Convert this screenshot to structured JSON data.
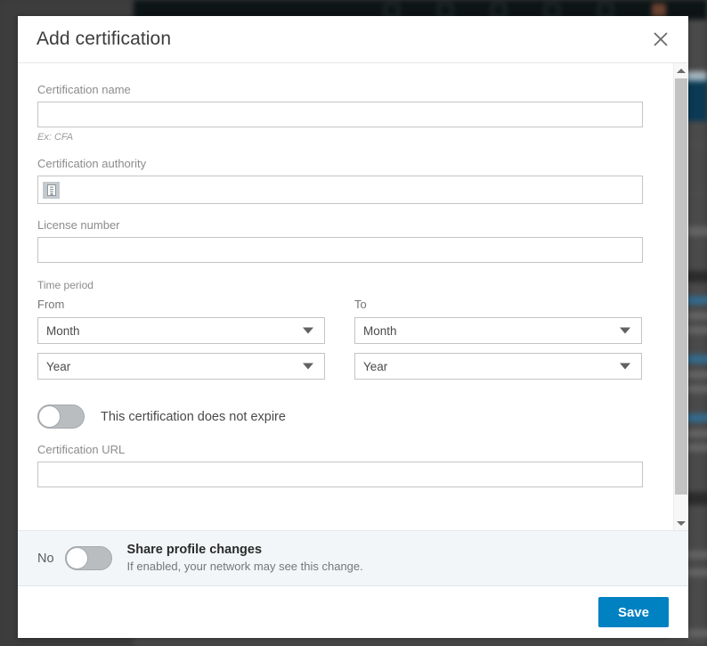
{
  "dialog": {
    "title": "Add certification",
    "close_icon": "close-icon"
  },
  "form": {
    "certification_name": {
      "label": "Certification name",
      "value": "",
      "placeholder": "",
      "hint": "Ex: CFA"
    },
    "certification_authority": {
      "label": "Certification authority",
      "value": "",
      "placeholder": "",
      "icon": "company-building-icon"
    },
    "license_number": {
      "label": "License number",
      "value": "",
      "placeholder": ""
    },
    "time_period": {
      "section_label": "Time period",
      "from": {
        "label": "From",
        "month": "Month",
        "year": "Year"
      },
      "to": {
        "label": "To",
        "month": "Month",
        "year": "Year"
      }
    },
    "no_expire_toggle": {
      "label": "This certification does not expire",
      "state": "off"
    },
    "certification_url": {
      "label": "Certification URL",
      "value": "",
      "placeholder": ""
    }
  },
  "share_bar": {
    "state_label": "No",
    "title": "Share profile changes",
    "subtitle": "If enabled, your network may see this change.",
    "toggle_state": "off"
  },
  "actions": {
    "save_label": "Save"
  },
  "colors": {
    "accent": "#0081c2",
    "share_bar_bg": "#f2f6f8",
    "border": "#c4c4c4",
    "label_text": "#8c8c8c",
    "title_text": "#3c3c3c"
  },
  "scrollbar": {
    "up_arrow": "caret-up-icon",
    "down_arrow": "caret-down-icon"
  }
}
